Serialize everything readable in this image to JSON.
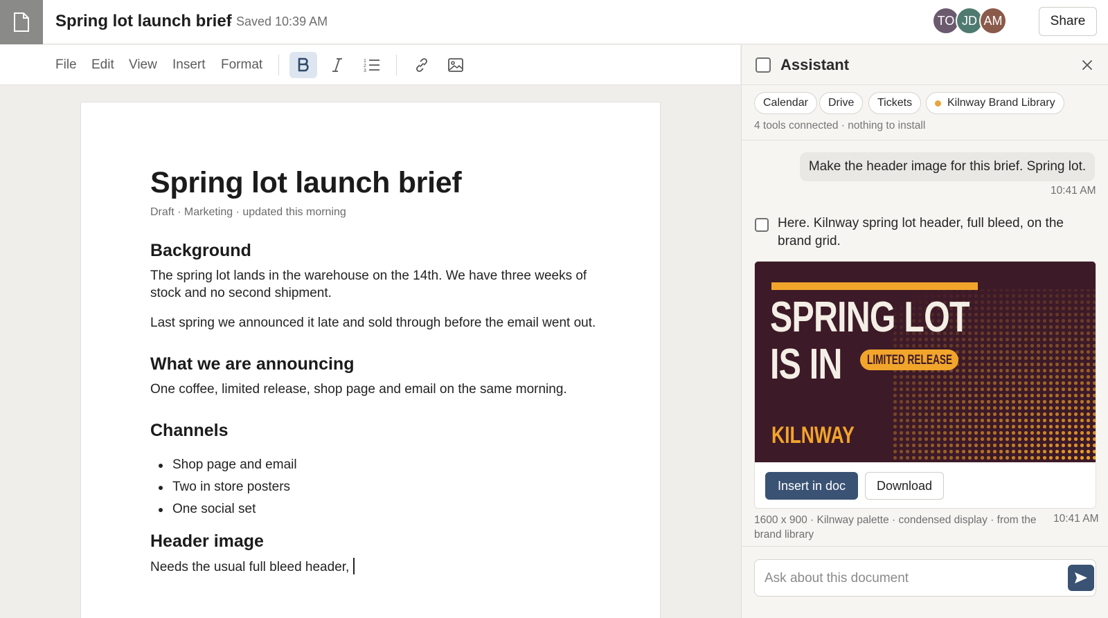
{
  "document": {
    "title": "Spring lot launch brief",
    "saved_status": "· Saved 10:39 AM",
    "meta": "Draft · Marketing · updated this morning",
    "sections": {
      "background_heading": "Background",
      "background_p1": "The spring lot lands in the warehouse on the 14th. We have three weeks of stock and no second shipment.",
      "background_p2": "Last spring we announced it late and sold through before the email went out.",
      "announcing_heading": "What we are announcing",
      "announcing_p": "One coffee, limited release, shop page and email on the same morning.",
      "channels_heading": "Channels",
      "channels_items": [
        "Shop page and email",
        "Two in store posters",
        "One social set"
      ],
      "header_heading": "Header image",
      "header_p": "Needs the usual full bleed header,"
    }
  },
  "collaborators": [
    {
      "initials": "TO",
      "color": "#6b5a6e"
    },
    {
      "initials": "JD",
      "color": "#4f7a6f"
    },
    {
      "initials": "AM",
      "color": "#8a5a4a"
    }
  ],
  "share_label": "Share",
  "toolbar": {
    "menus": [
      "File",
      "Edit",
      "View",
      "Insert",
      "Format"
    ],
    "tools": [
      "bold-icon",
      "italic-icon",
      "numbered-list-icon",
      "link-icon",
      "image-icon"
    ]
  },
  "assistant": {
    "title": "Assistant",
    "chips": [
      "Calendar",
      "Drive",
      "Tickets",
      "Kilnway Brand Library"
    ],
    "tools_note": "4 tools connected · nothing to install",
    "user_message": "Make the header image for this brief. Spring lot.",
    "user_time": "10:41 AM",
    "assistant_message": "Here. Kilnway spring lot header, full bleed, on the brand grid.",
    "banner": {
      "line1": "SPRING LOT",
      "line2": "IS IN",
      "badge": "LIMITED RELEASE",
      "brand": "KILNWAY",
      "accent": "#f2a52b",
      "background": "#3d1a28"
    },
    "insert_label": "Insert in doc",
    "download_label": "Download",
    "image_meta": "1600 x 900 · Kilnway palette · condensed display · from the brand library",
    "image_time": "10:41 AM",
    "input_placeholder": "Ask about this document"
  }
}
